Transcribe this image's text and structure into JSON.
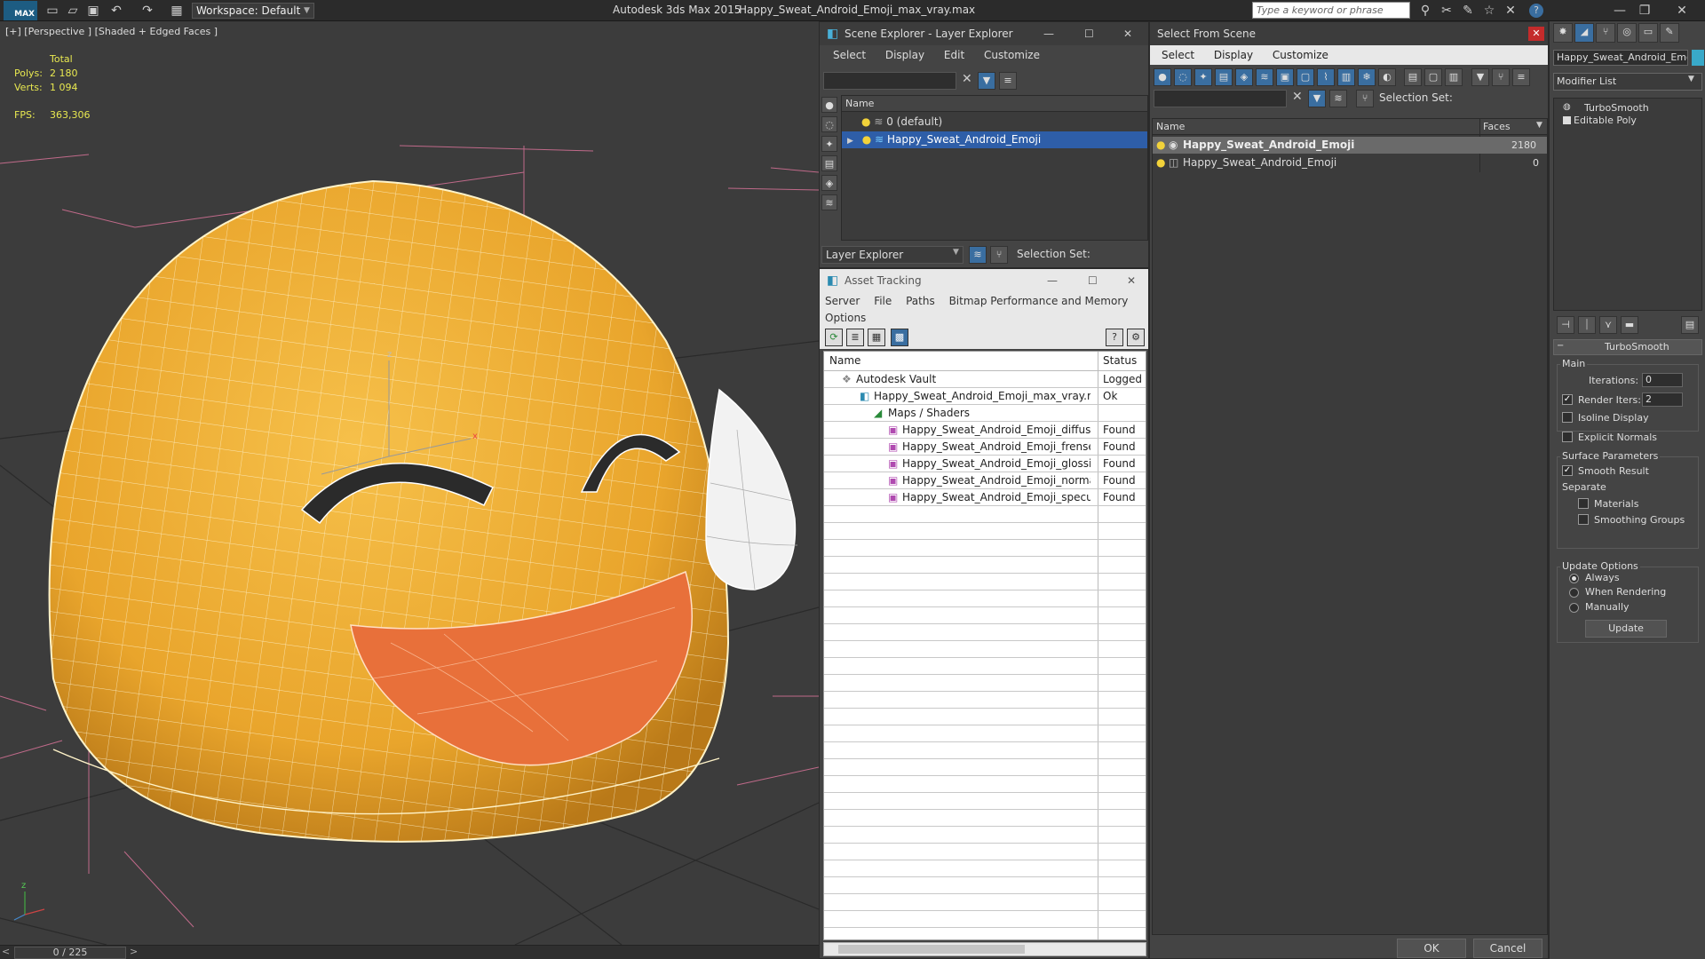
{
  "titlebar": {
    "logo": "MAX",
    "workspace": "Workspace: Default",
    "app_title": "Autodesk 3ds Max  2015",
    "doc_title": "Happy_Sweat_Android_Emoji_max_vray.max",
    "search_placeholder": "Type a keyword or phrase"
  },
  "viewport": {
    "label": "[+] [Perspective ] [Shaded + Edged Faces ]",
    "stats": {
      "total_label": "Total",
      "polys_label": "Polys:",
      "polys_value": "2 180",
      "verts_label": "Verts:",
      "verts_value": "1 094",
      "fps_label": "FPS:",
      "fps_value": "363,306"
    },
    "axis": {
      "z": "z",
      "x": "x"
    }
  },
  "timebar": {
    "frame": "0 / 225"
  },
  "scene_explorer": {
    "title": "Scene Explorer - Layer Explorer",
    "menu": [
      "Select",
      "Display",
      "Edit",
      "Customize"
    ],
    "column_name": "Name",
    "layers": [
      "0 (default)",
      "Happy_Sweat_Android_Emoji"
    ],
    "footer_dropdown": "Layer Explorer",
    "selection_set_label": "Selection Set:"
  },
  "asset_tracking": {
    "title": "Asset Tracking",
    "menu": [
      "Server",
      "File",
      "Paths",
      "Bitmap Performance and Memory"
    ],
    "menu2": [
      "Options"
    ],
    "col_name": "Name",
    "col_status": "Status",
    "rows": [
      {
        "name": "Autodesk Vault",
        "status": "Logged Ou"
      },
      {
        "name": "Happy_Sweat_Android_Emoji_max_vray.max",
        "status": "Ok"
      },
      {
        "name": "Maps / Shaders",
        "status": ""
      },
      {
        "name": "Happy_Sweat_Android_Emoji_diffuse.p...",
        "status": "Found"
      },
      {
        "name": "Happy_Sweat_Android_Emoji_frensel.p...",
        "status": "Found"
      },
      {
        "name": "Happy_Sweat_Android_Emoji_glossine...",
        "status": "Found"
      },
      {
        "name": "Happy_Sweat_Android_Emoji_normal....",
        "status": "Found"
      },
      {
        "name": "Happy_Sweat_Android_Emoji_specular...",
        "status": "Found"
      }
    ]
  },
  "select_from_scene": {
    "title": "Select From Scene",
    "menu": [
      "Select",
      "Display",
      "Customize"
    ],
    "selection_set_label": "Selection Set:",
    "col_name": "Name",
    "col_faces": "Faces",
    "rows": [
      {
        "name": "Happy_Sweat_Android_Emoji",
        "faces": "2180"
      },
      {
        "name": "Happy_Sweat_Android_Emoji",
        "faces": "0"
      }
    ],
    "ok": "OK",
    "cancel": "Cancel"
  },
  "command_panel": {
    "object_name": "Happy_Sweat_Android_Emoji",
    "modifier_list": "Modifier List",
    "stack": [
      "TurboSmooth",
      "Editable Poly"
    ],
    "rollout_title": "TurboSmooth",
    "main_label": "Main",
    "iterations_label": "Iterations:",
    "iterations_value": "0",
    "render_iters_label": "Render Iters:",
    "render_iters_value": "2",
    "isoline": "Isoline Display",
    "explicit_normals": "Explicit Normals",
    "surface_params": "Surface Parameters",
    "smooth_result": "Smooth Result",
    "separate": "Separate",
    "materials": "Materials",
    "smoothing_groups": "Smoothing Groups",
    "update_options": "Update Options",
    "always": "Always",
    "when_rendering": "When Rendering",
    "manually": "Manually",
    "update_button": "Update"
  }
}
